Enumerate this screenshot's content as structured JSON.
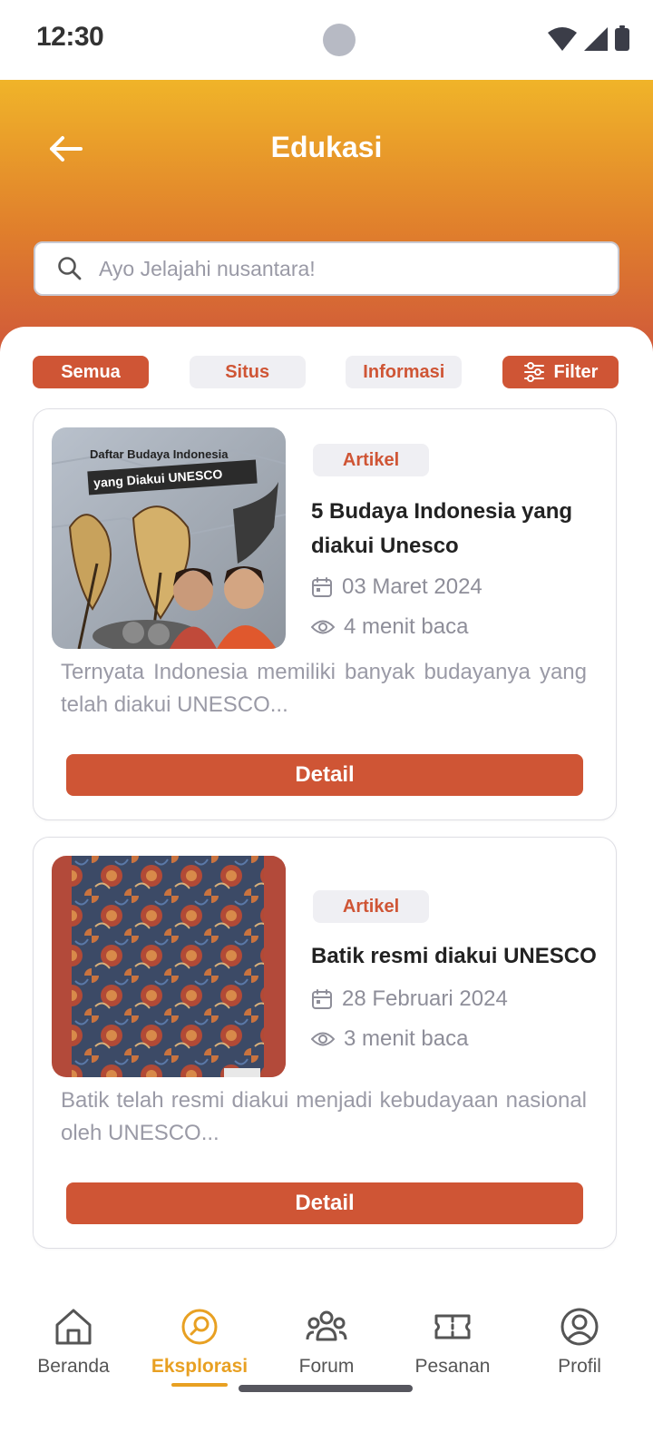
{
  "status_bar": {
    "time": "12:30"
  },
  "header": {
    "title": "Edukasi",
    "search_placeholder": "Ayo Jelajahi nusantara!"
  },
  "filters": {
    "chips": [
      "Semua",
      "Situs",
      "Informasi"
    ],
    "active": "Semua",
    "filter_label": "Filter"
  },
  "articles": [
    {
      "tag": "Artikel",
      "title": "5 Budaya Indonesia yang diakui Unesco",
      "date": "03 Maret 2024",
      "read_time": "4 menit baca",
      "description": "Ternyata Indonesia memiliki banyak budayanya yang telah diakui UNESCO...",
      "image_text_line1": "Daftar Budaya Indonesia",
      "image_text_line2": "yang Diakui UNESCO",
      "button": "Detail"
    },
    {
      "tag": "Artikel",
      "title": "Batik resmi diakui UNESCO",
      "date": "28 Februari 2024",
      "read_time": "3 menit baca",
      "description": "Batik telah resmi diakui menjadi kebudayaan nasional oleh UNESCO...",
      "button": "Detail"
    }
  ],
  "nav": {
    "items": [
      "Beranda",
      "Eksplorasi",
      "Forum",
      "Pesanan",
      "Profil"
    ],
    "active": "Eksplorasi"
  },
  "colors": {
    "primary": "#cf5535",
    "accent": "#e8a022",
    "header_top": "#f0b429",
    "header_bottom": "#d0593a"
  }
}
